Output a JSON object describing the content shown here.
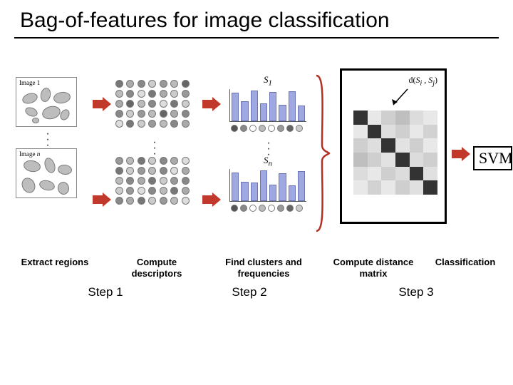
{
  "title": "Bag-of-features for image classification",
  "images": {
    "first_label": "Image 1",
    "last_label_prefix": "Image ",
    "last_label_var": "n"
  },
  "histograms": {
    "top_label_prefix": "S",
    "top_label_sub": "1",
    "bot_label_prefix": "S",
    "bot_label_sub": "n",
    "top_bars": [
      0.88,
      0.62,
      0.95,
      0.55,
      0.9,
      0.5,
      0.92,
      0.48
    ],
    "bot_bars": [
      0.9,
      0.6,
      0.58,
      0.95,
      0.52,
      0.88,
      0.5,
      0.93
    ],
    "codebook_shades": [
      "#555",
      "#888",
      "#fff",
      "#bbb",
      "#fff",
      "#999",
      "#666",
      "#ccc"
    ]
  },
  "descriptor_shades_top": [
    "#777",
    "#aaa",
    "#888",
    "#ccc",
    "#999",
    "#bbb",
    "#666",
    "#bbb",
    "#888",
    "#ddd",
    "#777",
    "#aaa",
    "#ccc",
    "#999",
    "#aaa",
    "#666",
    "#bbb",
    "#888",
    "#ddd",
    "#777",
    "#ccc",
    "#888",
    "#ccc",
    "#999",
    "#bbb",
    "#666",
    "#aaa",
    "#888",
    "#ddd",
    "#777",
    "#ccc",
    "#999",
    "#bbb",
    "#888",
    "#aaa"
  ],
  "descriptor_shades_bot": [
    "#999",
    "#bbb",
    "#777",
    "#ccc",
    "#888",
    "#aaa",
    "#ddd",
    "#777",
    "#ccc",
    "#999",
    "#bbb",
    "#888",
    "#ddd",
    "#aaa",
    "#bbb",
    "#888",
    "#aaa",
    "#777",
    "#ccc",
    "#999",
    "#888",
    "#ccc",
    "#999",
    "#ddd",
    "#888",
    "#bbb",
    "#777",
    "#aaa",
    "#888",
    "#aaa",
    "#777",
    "#ccc",
    "#999",
    "#bbb",
    "#ddd"
  ],
  "matrix": {
    "label_html": "d(S_i , S_j)",
    "cells": [
      "#333",
      "#e8e8e8",
      "#cfcfcf",
      "#bfbfbf",
      "#dcdcdc",
      "#e8e8e8",
      "#e8e8e8",
      "#333",
      "#dedede",
      "#cfcfcf",
      "#e8e8e8",
      "#d2d2d2",
      "#cfcfcf",
      "#dedede",
      "#333",
      "#e2e2e2",
      "#cfcfcf",
      "#e8e8e8",
      "#bfbfbf",
      "#cfcfcf",
      "#e2e2e2",
      "#333",
      "#dcdcdc",
      "#cfcfcf",
      "#dcdcdc",
      "#e8e8e8",
      "#cfcfcf",
      "#dcdcdc",
      "#333",
      "#e0e0e0",
      "#e8e8e8",
      "#d2d2d2",
      "#e8e8e8",
      "#cfcfcf",
      "#e0e0e0",
      "#333"
    ]
  },
  "svm_label": "SVM",
  "captions": {
    "c1": "Extract regions",
    "c2": "Compute descriptors",
    "c3": "Find clusters and frequencies",
    "c4": "Compute distance matrix",
    "c5": "Classification"
  },
  "steps": {
    "s1": "Step 1",
    "s2": "Step 2",
    "s3": "Step 3"
  },
  "colors": {
    "arrow": "#c0392b",
    "brace": "#b03024"
  }
}
